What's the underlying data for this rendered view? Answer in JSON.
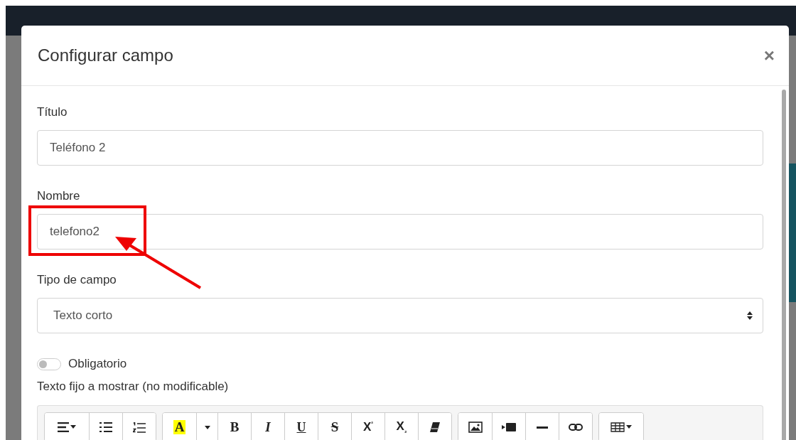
{
  "dialog": {
    "title": "Configurar campo",
    "close": "×"
  },
  "fields": [
    {
      "kind": "input",
      "label": "Título",
      "value": "Teléfono 2"
    },
    {
      "kind": "input",
      "label": "Nombre",
      "value": "telefono2",
      "annotated": true
    },
    {
      "kind": "select",
      "label": "Tipo de campo",
      "value": "Texto corto"
    }
  ],
  "required_toggle": {
    "label": "Obligatorio",
    "on": false
  },
  "editor": {
    "label": "Texto fijo a mostrar (no modificable)",
    "toolbar": [
      [
        {
          "kind": "align-dropdown"
        },
        {
          "kind": "bullet-list"
        },
        {
          "kind": "numbered-list"
        }
      ],
      [
        {
          "kind": "highlight",
          "text": "A"
        },
        {
          "kind": "caret"
        },
        {
          "kind": "bold",
          "text": "B"
        },
        {
          "kind": "italic",
          "text": "I"
        },
        {
          "kind": "underline",
          "text": "U"
        },
        {
          "kind": "strike",
          "text": "S"
        },
        {
          "kind": "superscript",
          "text": "X",
          "mark": "²"
        },
        {
          "kind": "subscript",
          "text": "X",
          "mark": "₂"
        },
        {
          "kind": "eraser"
        }
      ],
      [
        {
          "kind": "image"
        },
        {
          "kind": "video"
        },
        {
          "kind": "rule"
        },
        {
          "kind": "link"
        }
      ],
      [
        {
          "kind": "table-dropdown"
        }
      ]
    ]
  }
}
